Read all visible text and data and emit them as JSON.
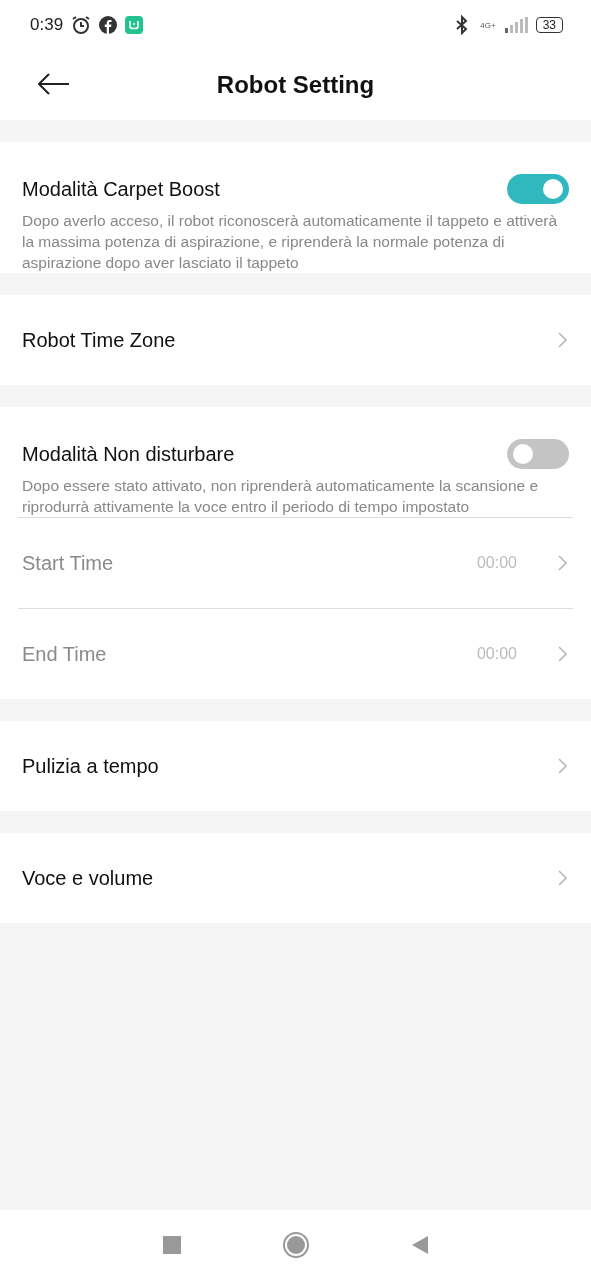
{
  "status_bar": {
    "time": "0:39",
    "network": "4G+",
    "battery": "33"
  },
  "header": {
    "title": "Robot Setting"
  },
  "groups": [
    {
      "rows": [
        {
          "kind": "toggle",
          "label": "Modalità Carpet Boost",
          "on": true,
          "description": "Dopo averlo acceso, il robot riconoscerà automaticamente il tappeto e attiverà la massima potenza di aspirazione, e riprenderà la normale potenza di aspirazione dopo aver lasciato il tappeto"
        }
      ]
    },
    {
      "rows": [
        {
          "kind": "link",
          "label": "Robot Time Zone"
        }
      ]
    },
    {
      "rows": [
        {
          "kind": "toggle",
          "label": "Modalità Non disturbare",
          "on": false,
          "description": "Dopo essere stato attivato, non riprenderà automaticamente la scansione e riprodurrà attivamente la voce entro il periodo di tempo impostato"
        },
        {
          "kind": "time",
          "label": "Start Time",
          "value": "00:00",
          "disabled": true
        },
        {
          "kind": "time",
          "label": "End Time",
          "value": "00:00",
          "disabled": true
        }
      ]
    },
    {
      "rows": [
        {
          "kind": "link",
          "label": "Pulizia a tempo"
        }
      ]
    },
    {
      "rows": [
        {
          "kind": "link",
          "label": "Voce e volume"
        }
      ]
    }
  ]
}
